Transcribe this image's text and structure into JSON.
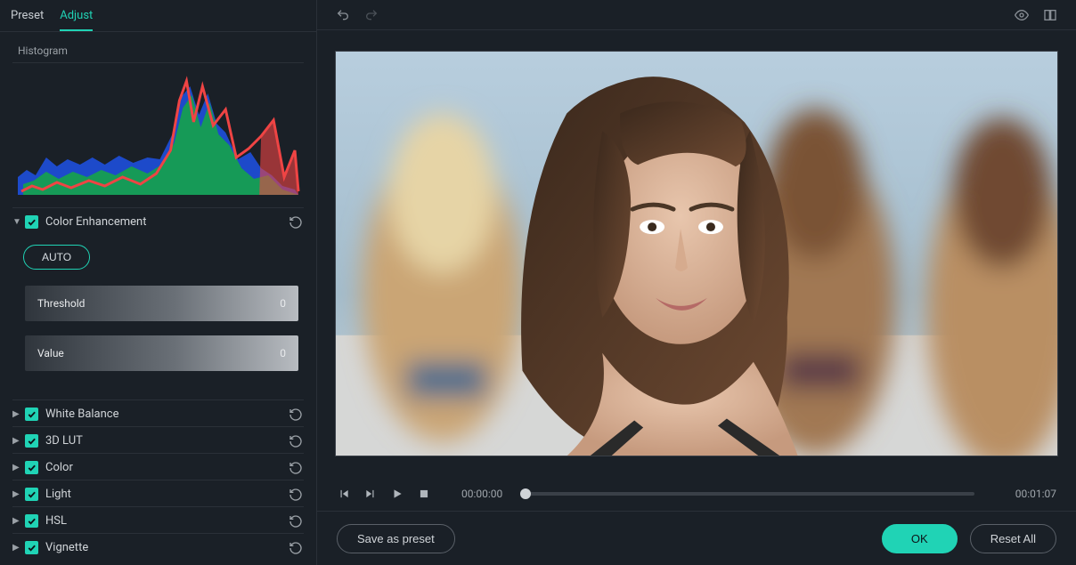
{
  "tabs": {
    "preset": "Preset",
    "adjust": "Adjust"
  },
  "histogram": {
    "title": "Histogram"
  },
  "sections": {
    "color_enhancement": {
      "label": "Color Enhancement",
      "auto_label": "AUTO",
      "threshold": {
        "label": "Threshold",
        "value": "0"
      },
      "value": {
        "label": "Value",
        "value": "0"
      }
    },
    "white_balance": {
      "label": "White Balance"
    },
    "lut3d": {
      "label": "3D LUT"
    },
    "color": {
      "label": "Color"
    },
    "light": {
      "label": "Light"
    },
    "hsl": {
      "label": "HSL"
    },
    "vignette": {
      "label": "Vignette"
    }
  },
  "transport": {
    "current": "00:00:00",
    "duration": "00:01:07"
  },
  "buttons": {
    "save_preset": "Save as preset",
    "ok": "OK",
    "reset_all": "Reset All"
  }
}
